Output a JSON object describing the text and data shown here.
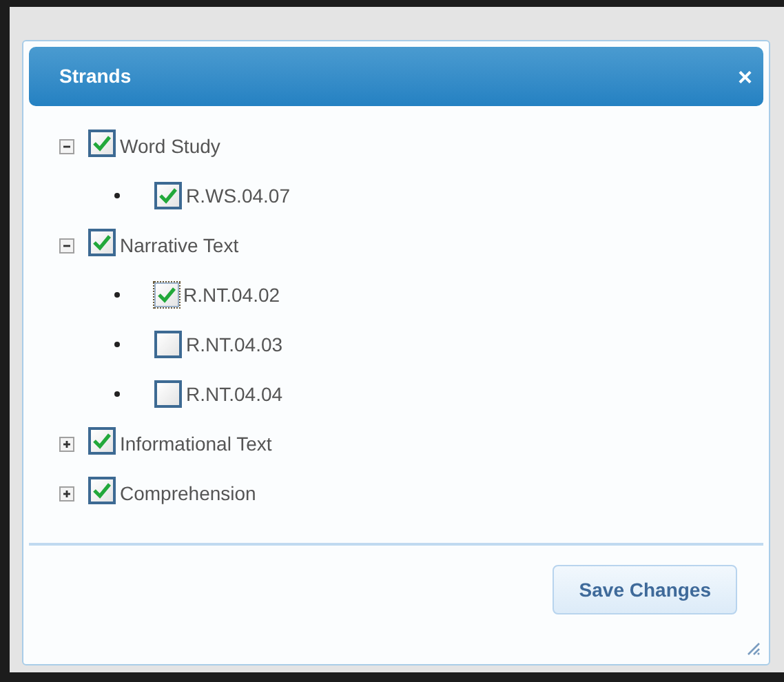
{
  "dialog": {
    "title": "Strands",
    "close": "×"
  },
  "tree": [
    {
      "label": "Word Study",
      "checked": true,
      "expanded": true,
      "children": [
        {
          "label": "R.WS.04.07",
          "checked": true,
          "focused": false
        }
      ]
    },
    {
      "label": "Narrative Text",
      "checked": true,
      "expanded": true,
      "children": [
        {
          "label": "R.NT.04.02",
          "checked": true,
          "focused": true
        },
        {
          "label": "R.NT.04.03",
          "checked": false,
          "focused": false
        },
        {
          "label": "R.NT.04.04",
          "checked": false,
          "focused": false
        }
      ]
    },
    {
      "label": "Informational Text",
      "checked": true,
      "expanded": false
    },
    {
      "label": "Comprehension",
      "checked": true,
      "expanded": false
    }
  ],
  "save_button": "Save Changes"
}
